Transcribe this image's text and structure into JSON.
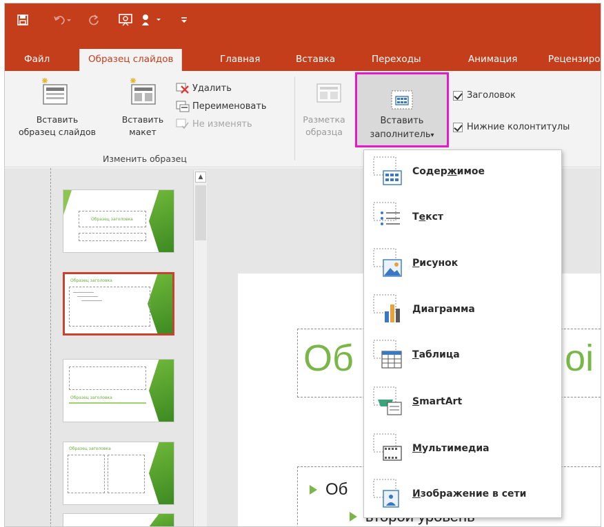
{
  "quick_access": {
    "icons": [
      "save-icon",
      "undo-icon",
      "redo-icon",
      "presentation-icon",
      "touch-mode-icon",
      "customize-icon"
    ]
  },
  "tabs": [
    {
      "label": "Файл"
    },
    {
      "label": "Образец слайдов",
      "active": true
    },
    {
      "label": "Главная"
    },
    {
      "label": "Вставка"
    },
    {
      "label": "Переходы"
    },
    {
      "label": "Анимация"
    },
    {
      "label": "Рецензирование"
    }
  ],
  "ribbon": {
    "insert_slide_master": {
      "line1": "Вставить",
      "line2": "образец слайдов"
    },
    "insert_layout": {
      "line1": "Вставить",
      "line2": "макет"
    },
    "delete": "Удалить",
    "rename": "Переименовать",
    "preserve": "Не изменять",
    "group_edit_master": "Изменить образец",
    "master_layout": {
      "line1": "Разметка",
      "line2": "образца"
    },
    "insert_placeholder": {
      "line1": "Вставить",
      "line2": "заполнитель",
      "dropdown": "▾"
    },
    "title_checkbox": "Заголовок",
    "footers_checkbox": "Нижние колонтитулы"
  },
  "menu": {
    "items": [
      {
        "pre": "Содер",
        "key": "ж",
        "post": "имое",
        "icon": "content-placeholder-icon"
      },
      {
        "pre": "Т",
        "key": "е",
        "post": "кст",
        "icon": "text-placeholder-icon"
      },
      {
        "pre": "",
        "key": "Р",
        "post": "исунок",
        "icon": "picture-placeholder-icon"
      },
      {
        "pre": "",
        "key": "Д",
        "post": "иаграмма",
        "icon": "chart-placeholder-icon"
      },
      {
        "pre": "",
        "key": "Т",
        "post": "аблица",
        "icon": "table-placeholder-icon"
      },
      {
        "pre": "",
        "key": "S",
        "post": "martArt",
        "icon": "smartart-placeholder-icon"
      },
      {
        "pre": "",
        "key": "М",
        "post": "ультимедиа",
        "icon": "media-placeholder-icon"
      },
      {
        "pre": "",
        "key": "И",
        "post": "зображение в сети",
        "icon": "online-image-placeholder-icon"
      }
    ]
  },
  "thumbnails": [
    {
      "title": "Образец заголовка",
      "selected": false
    },
    {
      "title": "Образец заголовка",
      "selected": true
    },
    {
      "title": "Образец заголовка",
      "selected": false
    },
    {
      "title": "Образец заголовка",
      "selected": false
    },
    {
      "title": "",
      "selected": false
    }
  ],
  "slide": {
    "title_left": "Об",
    "title_right": "лоі",
    "bullet1": "Об",
    "bullet2": "второй уровень"
  },
  "colors": {
    "accent": "#c43e1c",
    "highlight": "#e619c8",
    "green": "#7ab648",
    "selected_thumb": "#c8432d"
  }
}
